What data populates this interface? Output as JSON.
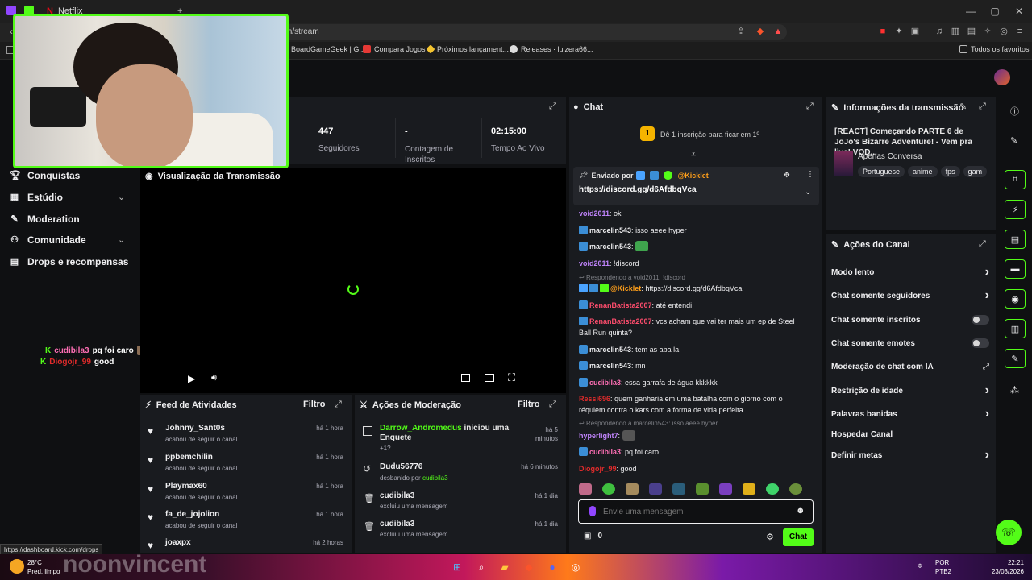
{
  "browser": {
    "tabs": [
      {
        "label": ""
      },
      {
        "label": ""
      },
      {
        "label": "Netflix"
      }
    ],
    "url": "m/stream",
    "bookmarks": [
      "BoardGameGeek | G...",
      "Compara Jogos",
      "Próximos lançament...",
      "Releases · luizera66..."
    ],
    "all_bookmarks": "Todos os favoritos",
    "status_url": "https://dashboard.kick.com/drops"
  },
  "sidebar": {
    "items": [
      {
        "label": "Conquistas",
        "icon": "trophy-icon"
      },
      {
        "label": "Estúdio",
        "icon": "studio-icon"
      },
      {
        "label": "Moderation",
        "icon": "wrench-icon"
      },
      {
        "label": "Comunidade",
        "icon": "people-icon"
      },
      {
        "label": "Drops e recompensas",
        "icon": "gift-icon"
      }
    ],
    "overlay_chat": [
      {
        "user": "cudibila3",
        "text": "pq foi caro",
        "color": "#ff6fb5"
      },
      {
        "user": "Diogojr_99",
        "text": "good",
        "color": "#e02b2b"
      }
    ]
  },
  "stats": [
    {
      "value": "447",
      "label": "Seguidores"
    },
    {
      "value": "-",
      "label": "Contagem de Inscritos"
    },
    {
      "value": "02:15:00",
      "label": "Tempo Ao Vivo"
    }
  ],
  "preview": {
    "title": "Visualização da Transmissão"
  },
  "feed": {
    "title": "Feed de Atividades",
    "filter": "Filtro",
    "items": [
      {
        "name": "Johnny_Sant0s",
        "sub": "acabou de seguir o canal",
        "time": "há 1 hora"
      },
      {
        "name": "ppbemchilin",
        "sub": "acabou de seguir o canal",
        "time": "há 1 hora"
      },
      {
        "name": "Playmax60",
        "sub": "acabou de seguir o canal",
        "time": "há 1 hora"
      },
      {
        "name": "fa_de_jojolion",
        "sub": "acabou de seguir o canal",
        "time": "há 1 hora"
      },
      {
        "name": "joaxpx",
        "sub": "",
        "time": "há 2 horas"
      }
    ]
  },
  "mod": {
    "title": "Ações de Moderação",
    "filter": "Filtro",
    "items": [
      {
        "name": "Darrow_Andromedus",
        "action": "iniciou uma Enquete",
        "sub": "+1?",
        "time": "há 5 minutos"
      },
      {
        "name": "Dudu56776",
        "action": "",
        "sub": "desbanido por",
        "by": "cudibila3",
        "time": "há 6 minutos"
      },
      {
        "name": "cudibila3",
        "action": "",
        "sub": "excluiu uma mensagem",
        "time": "há 1 dia"
      },
      {
        "name": "cudibila3",
        "action": "",
        "sub": "excluiu uma mensagem",
        "time": "há 1 dia"
      }
    ]
  },
  "chat": {
    "title": "Chat",
    "sub_goal_num": "1",
    "sub_goal": "Dê 1 inscrição para ficar em 1º",
    "pinned_by": "Enviado por",
    "pinned_user": "@Kicklet",
    "pinned_link": "https://discord.gg/d6AfdbqVca",
    "messages": [
      {
        "user": "void2011",
        "color": "#c084fc",
        "text": "ok"
      },
      {
        "user": "marcelin543",
        "color": "#efeff1",
        "text": "isso aeee hyper"
      },
      {
        "user": "marcelin543",
        "color": "#efeff1",
        "text": ""
      },
      {
        "user": "void2011",
        "color": "#c084fc",
        "text": "!discord"
      },
      {
        "reply": "Respondendo a void2011: !discord"
      },
      {
        "user": "@Kicklet",
        "color": "#ff9f1a",
        "text": "https://discord.gg/d6AfdbqVca"
      },
      {
        "user": "RenanBatista2007",
        "color": "#ff4d6d",
        "text": "até entendi"
      },
      {
        "user": "RenanBatista2007",
        "color": "#ff4d6d",
        "text": "vcs acham que vai ter mais um ep de Steel Ball Run quinta?"
      },
      {
        "user": "marcelin543",
        "color": "#efeff1",
        "text": "tem as aba la"
      },
      {
        "user": "marcelin543",
        "color": "#efeff1",
        "text": "mn"
      },
      {
        "user": "cudibila3",
        "color": "#ff6fb5",
        "text": "essa garrafa de água kkkkkk"
      },
      {
        "user": "Ressi696",
        "color": "#e02b2b",
        "text": "quem ganharia em uma batalha com o giorno com o réquiem contra o kars com a forma de vida perfeita"
      },
      {
        "reply": "Respondendo a marcelin543: isso aeee hyper"
      },
      {
        "user": "hyperlight7",
        "color": "#c084fc",
        "text": ""
      },
      {
        "user": "cudibila3",
        "color": "#ff6fb5",
        "text": "pq foi caro"
      },
      {
        "user": "Diogojr_99",
        "color": "#e02b2b",
        "text": "good"
      }
    ],
    "placeholder": "Envie uma mensagem",
    "count": "0",
    "send": "Chat"
  },
  "info": {
    "title": "Informações da transmissão",
    "stream_title": "[REACT] Começando PARTE 6 de JoJo's Bizarre Adventure! - Vem pra live! VOD...",
    "category": "Apenas Conversa",
    "tags": [
      "Portuguese",
      "anime",
      "fps",
      "gam"
    ]
  },
  "actions": {
    "title": "Ações do Canal",
    "items": [
      {
        "label": "Modo lento",
        "kind": "chevron"
      },
      {
        "label": "Chat somente seguidores",
        "kind": "chevron"
      },
      {
        "label": "Chat somente inscritos",
        "kind": "toggle"
      },
      {
        "label": "Chat somente emotes",
        "kind": "toggle"
      },
      {
        "label": "Moderação de chat com IA",
        "kind": "link"
      },
      {
        "label": "Restrição de idade",
        "kind": "chevron"
      },
      {
        "label": "Palavras banidas",
        "kind": "chevron"
      },
      {
        "label": "Hospedar Canal",
        "kind": "none"
      },
      {
        "label": "Definir metas",
        "kind": "chevron"
      }
    ]
  },
  "taskbar": {
    "weather_temp": "28°C",
    "weather_desc": "Pred. limpo",
    "overlay_text": "noonvincent",
    "lang": "POR",
    "layout": "PTB2",
    "time": "22:21",
    "date": "23/03/2026"
  }
}
